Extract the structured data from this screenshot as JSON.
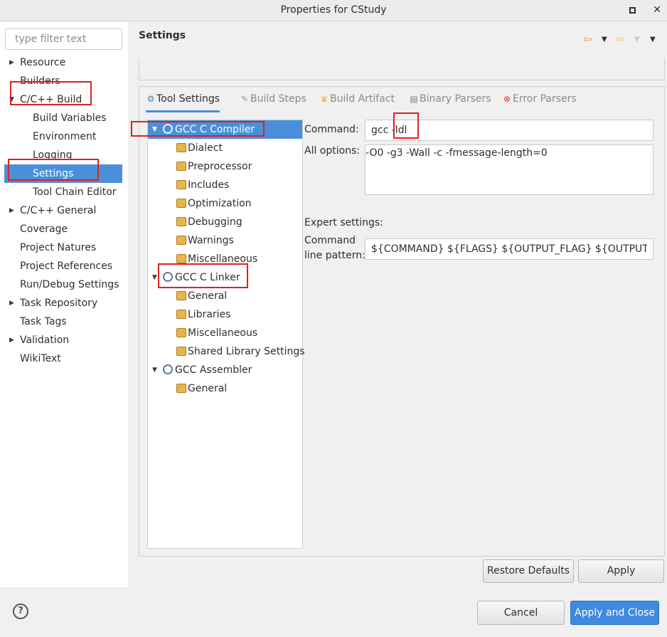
{
  "window": {
    "title": "Properties for CStudy",
    "maximize_label": "",
    "close_label": "✕"
  },
  "left": {
    "filter_placeholder": "type filter text",
    "tree": [
      {
        "label": "Resource"
      },
      {
        "label": "Builders"
      },
      {
        "label": "C/C++ Build"
      },
      {
        "label": "Build Variables"
      },
      {
        "label": "Environment"
      },
      {
        "label": "Logging"
      },
      {
        "label": "Settings"
      },
      {
        "label": "Tool Chain Editor"
      },
      {
        "label": "C/C++ General"
      },
      {
        "label": "Coverage"
      },
      {
        "label": "Project Natures"
      },
      {
        "label": "Project References"
      },
      {
        "label": "Run/Debug Settings"
      },
      {
        "label": "Task Repository"
      },
      {
        "label": "Task Tags"
      },
      {
        "label": "Validation"
      },
      {
        "label": "WikiText"
      }
    ]
  },
  "main": {
    "title": "Settings",
    "tabs": [
      {
        "label": "Tool Settings",
        "icon": "tool-settings-icon"
      },
      {
        "label": "Build Steps",
        "icon": "build-steps-icon"
      },
      {
        "label": "Build Artifact",
        "icon": "build-artifact-icon"
      },
      {
        "label": "Binary Parsers",
        "icon": "binary-parsers-icon"
      },
      {
        "label": "Error Parsers",
        "icon": "error-parsers-icon"
      }
    ],
    "tool_tree": [
      {
        "label": "GCC C Compiler"
      },
      {
        "label": "Dialect"
      },
      {
        "label": "Preprocessor"
      },
      {
        "label": "Includes"
      },
      {
        "label": "Optimization"
      },
      {
        "label": "Debugging"
      },
      {
        "label": "Warnings"
      },
      {
        "label": "Miscellaneous"
      },
      {
        "label": "GCC C Linker"
      },
      {
        "label": "General"
      },
      {
        "label": "Libraries"
      },
      {
        "label": "Miscellaneous"
      },
      {
        "label": "Shared Library Settings"
      },
      {
        "label": "GCC Assembler"
      },
      {
        "label": "General"
      }
    ],
    "command_label": "Command:",
    "command_value": "gcc -ldl",
    "all_options_label": "All options:",
    "all_options_value": "-O0 -g3 -Wall -c -fmessage-length=0",
    "expert_label": "Expert settings:",
    "pattern_label_1": "Command",
    "pattern_label_2": "line pattern:",
    "pattern_value": "${COMMAND} ${FLAGS} ${OUTPUT_FLAG} ${OUTPUT_PREFIX}${OUTPUT} ${INPUTS}"
  },
  "buttons": {
    "restore_defaults": "Restore Defaults",
    "apply": "Apply",
    "cancel": "Cancel",
    "apply_and_close": "Apply and Close",
    "help": "?"
  },
  "colors": {
    "selection": "#4a90d9",
    "annotation": "#e02020",
    "primary_button": "#3f8ae0"
  }
}
